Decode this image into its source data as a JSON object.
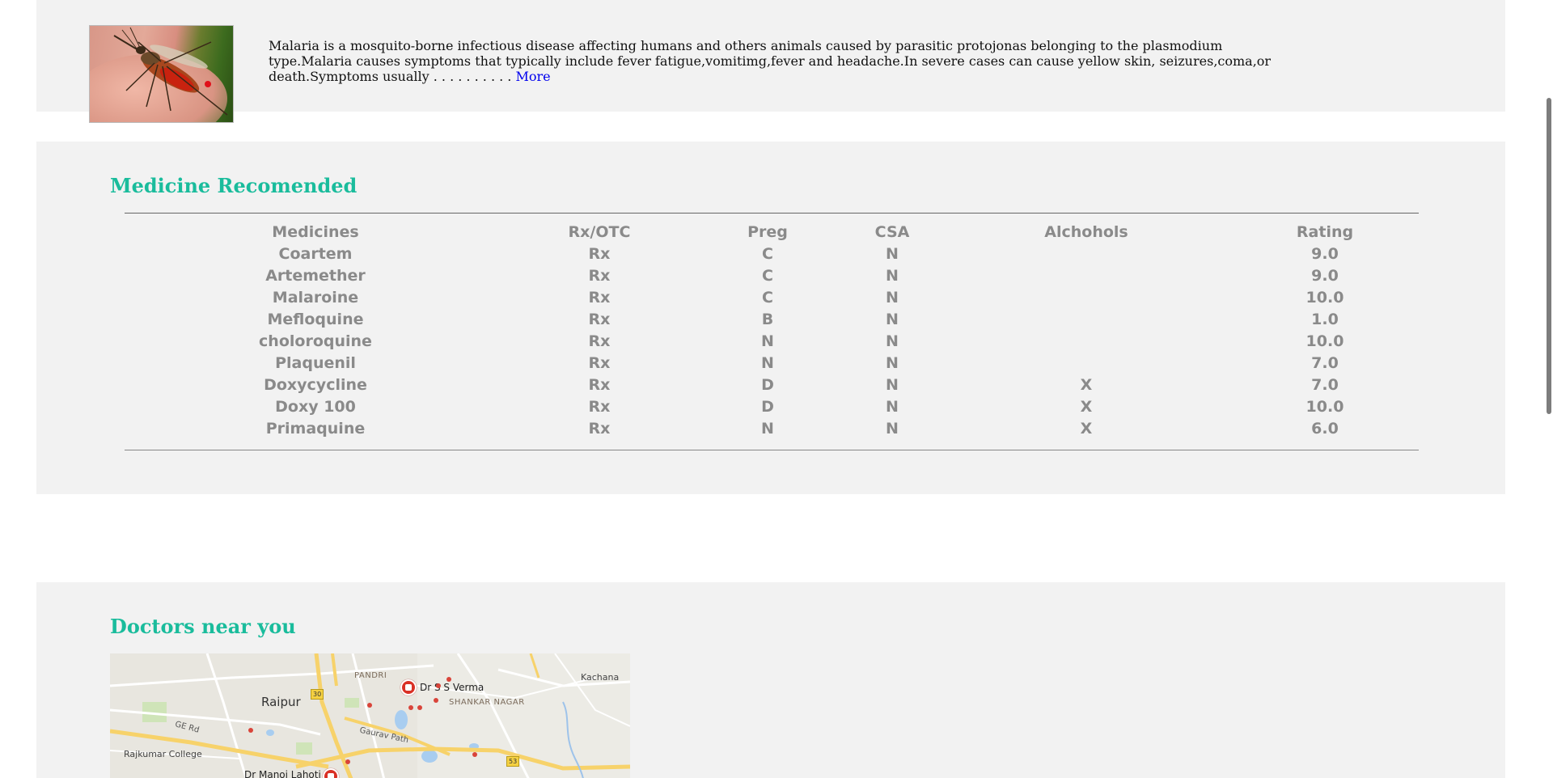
{
  "info": {
    "text": "Malaria is a mosquito-borne infectious disease affecting humans and others animals caused by parasitic protojonas belonging to the plasmodium type.Malaria causes symptoms that typically include fever fatigue,vomitimg,fever and headache.In severe cases can cause yellow skin, seizures,coma,or death.Symptoms usually . . . . . . . . . . ",
    "more_label": "More"
  },
  "medicine": {
    "title": "Medicine Recomended",
    "headers": [
      "Medicines",
      "Rx/OTC",
      "Preg",
      "CSA",
      "Alchohols",
      "Rating"
    ],
    "rows": [
      [
        "Coartem",
        "Rx",
        "C",
        "N",
        "",
        "9.0"
      ],
      [
        "Artemether",
        "Rx",
        "C",
        "N",
        "",
        "9.0"
      ],
      [
        "Malaroine",
        "Rx",
        "C",
        "N",
        "",
        "10.0"
      ],
      [
        "Mefloquine",
        "Rx",
        "B",
        "N",
        "",
        "1.0"
      ],
      [
        "choloroquine",
        "Rx",
        "N",
        "N",
        "",
        "10.0"
      ],
      [
        "Plaquenil",
        "Rx",
        "N",
        "N",
        "",
        "7.0"
      ],
      [
        "Doxycycline",
        "Rx",
        "D",
        "N",
        "X",
        "7.0"
      ],
      [
        "Doxy 100",
        "Rx",
        "D",
        "N",
        "X",
        "10.0"
      ],
      [
        "Primaquine",
        "Rx",
        "N",
        "N",
        "X",
        "6.0"
      ]
    ]
  },
  "doctors": {
    "title": "Doctors near you",
    "map": {
      "city": "Raipur",
      "areas": [
        "PANDRI",
        "SHANKAR NAGAR",
        "Kachana"
      ],
      "roads": [
        "GE Rd",
        "Gaurav Path"
      ],
      "shields": [
        "30",
        "53"
      ],
      "places": [
        "Rajkumar College"
      ],
      "doctors": [
        "Dr S S Verma",
        "Dr Manoj Lahoti"
      ]
    }
  },
  "colors": {
    "accent": "#1abc9c",
    "panel_bg": "#f2f2f2",
    "table_text": "#8a8a8a",
    "link": "#0000ee"
  }
}
